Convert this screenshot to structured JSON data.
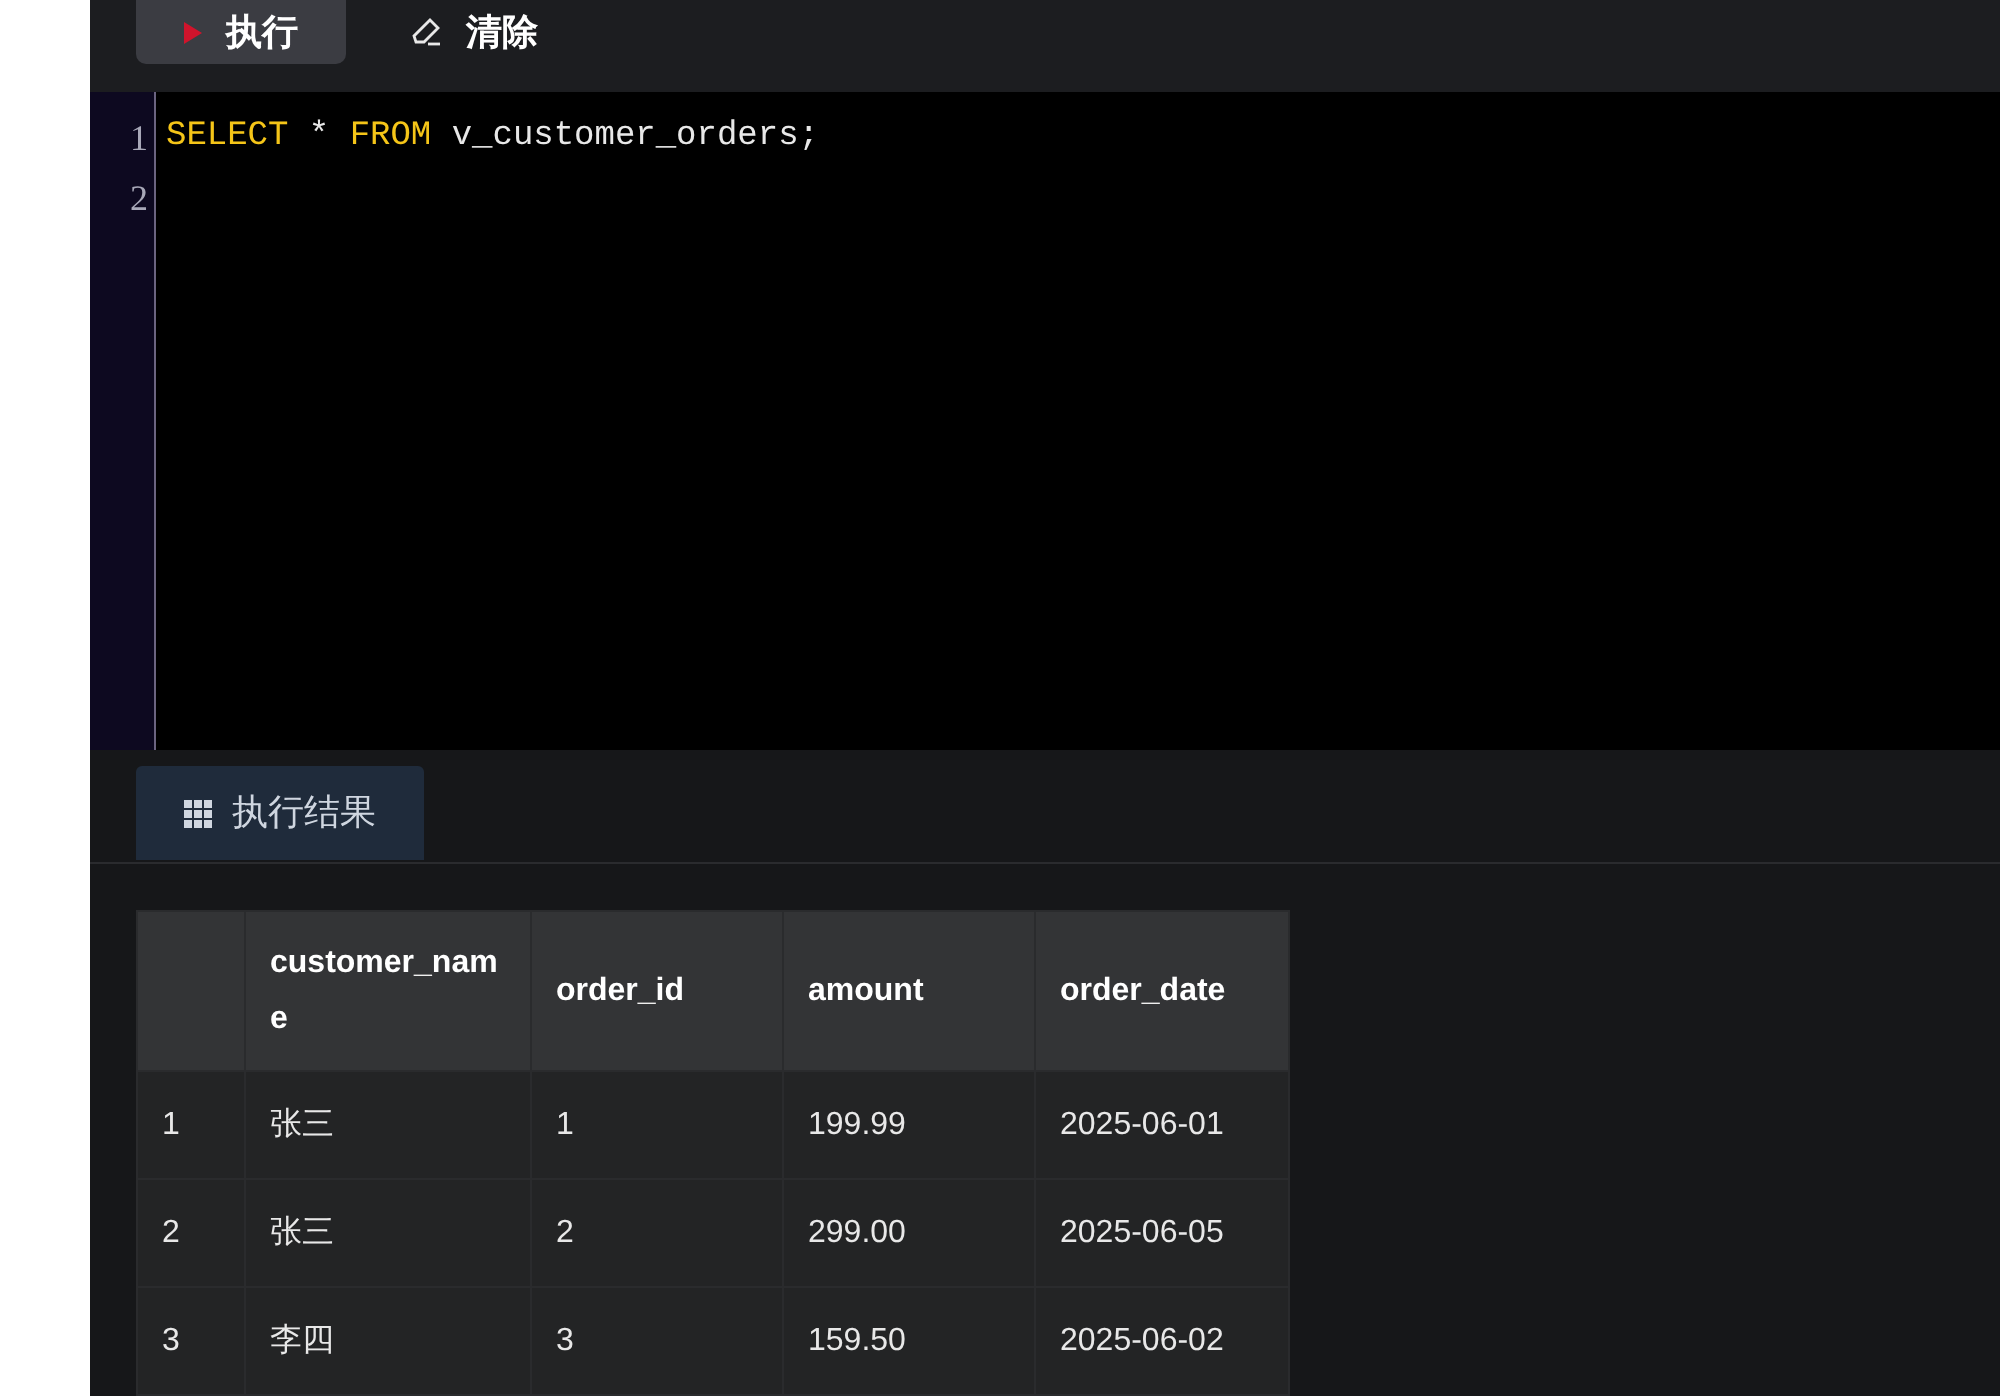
{
  "toolbar": {
    "buttons": [
      {
        "label": "执行",
        "kind": "run",
        "selected": true
      },
      {
        "label": "清除",
        "kind": "clear",
        "selected": false
      }
    ]
  },
  "editor": {
    "lines": [
      {
        "number": "1",
        "tokens": [
          {
            "text": "SELECT",
            "kind": "keyword"
          },
          {
            "text": " * ",
            "kind": "plain"
          },
          {
            "text": "FROM",
            "kind": "keyword"
          },
          {
            "text": " v_customer_orders;",
            "kind": "plain"
          }
        ]
      },
      {
        "number": "2"
      }
    ]
  },
  "results": {
    "tabs": [
      {
        "label": "执行结果",
        "selected": true
      }
    ],
    "table": {
      "columns": [
        "customer_name",
        "order_id",
        "amount",
        "order_date"
      ],
      "rows": [
        {
          "index": "1",
          "cells": [
            "张三",
            "1",
            "199.99",
            "2025-06-01"
          ]
        },
        {
          "index": "2",
          "cells": [
            "张三",
            "2",
            "299.00",
            "2025-06-05"
          ]
        },
        {
          "index": "3",
          "cells": [
            "李四",
            "3",
            "159.50",
            "2025-06-02"
          ]
        }
      ]
    }
  }
}
